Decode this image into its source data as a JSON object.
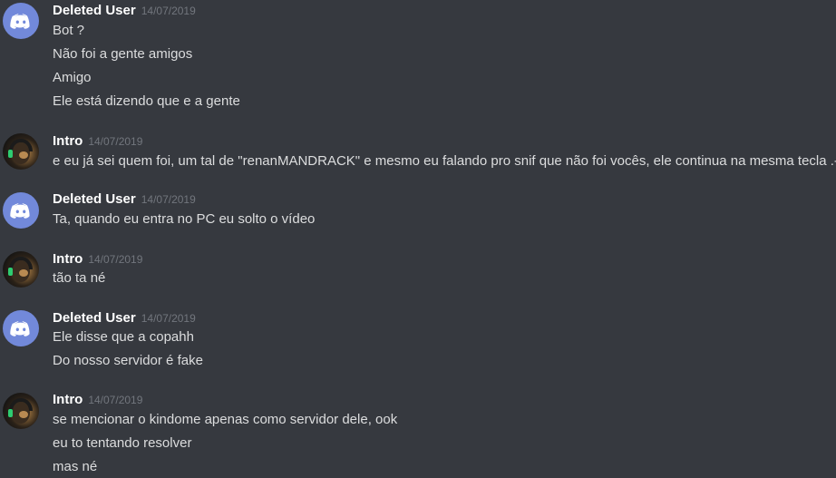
{
  "messages": [
    {
      "author": "Deleted User",
      "timestamp": "14/07/2019",
      "avatar": "discord-default-avatar-icon",
      "lines": [
        "Bot ?",
        "Não foi a gente amigos",
        "Amigo",
        "Ele está dizendo que e a gente"
      ]
    },
    {
      "author": "Intro",
      "timestamp": "14/07/2019",
      "avatar": "user-photo-avatar",
      "lines": [
        "e eu já sei quem foi, um tal de \"renanMANDRACK\" e mesmo eu falando pro snif que não foi vocês, ele continua na mesma tecla .-."
      ]
    },
    {
      "author": "Deleted User",
      "timestamp": "14/07/2019",
      "avatar": "discord-default-avatar-icon",
      "lines": [
        "Ta, quando eu entra no PC eu solto o vídeo"
      ]
    },
    {
      "author": "Intro",
      "timestamp": "14/07/2019",
      "avatar": "user-photo-avatar",
      "lines": [
        "tão ta né"
      ]
    },
    {
      "author": "Deleted User",
      "timestamp": "14/07/2019",
      "avatar": "discord-default-avatar-icon",
      "lines": [
        "Ele disse que a copahh",
        "Do nosso servidor é fake"
      ]
    },
    {
      "author": "Intro",
      "timestamp": "14/07/2019",
      "avatar": "user-photo-avatar",
      "lines": [
        "se mencionar o kindome apenas como servidor dele, ook",
        "eu to tentando resolver",
        "mas né"
      ]
    }
  ],
  "colors": {
    "background": "#36393f",
    "text": "#dcddde",
    "username": "#ffffff",
    "timestamp": "#72767d",
    "blurple": "#7289da"
  }
}
